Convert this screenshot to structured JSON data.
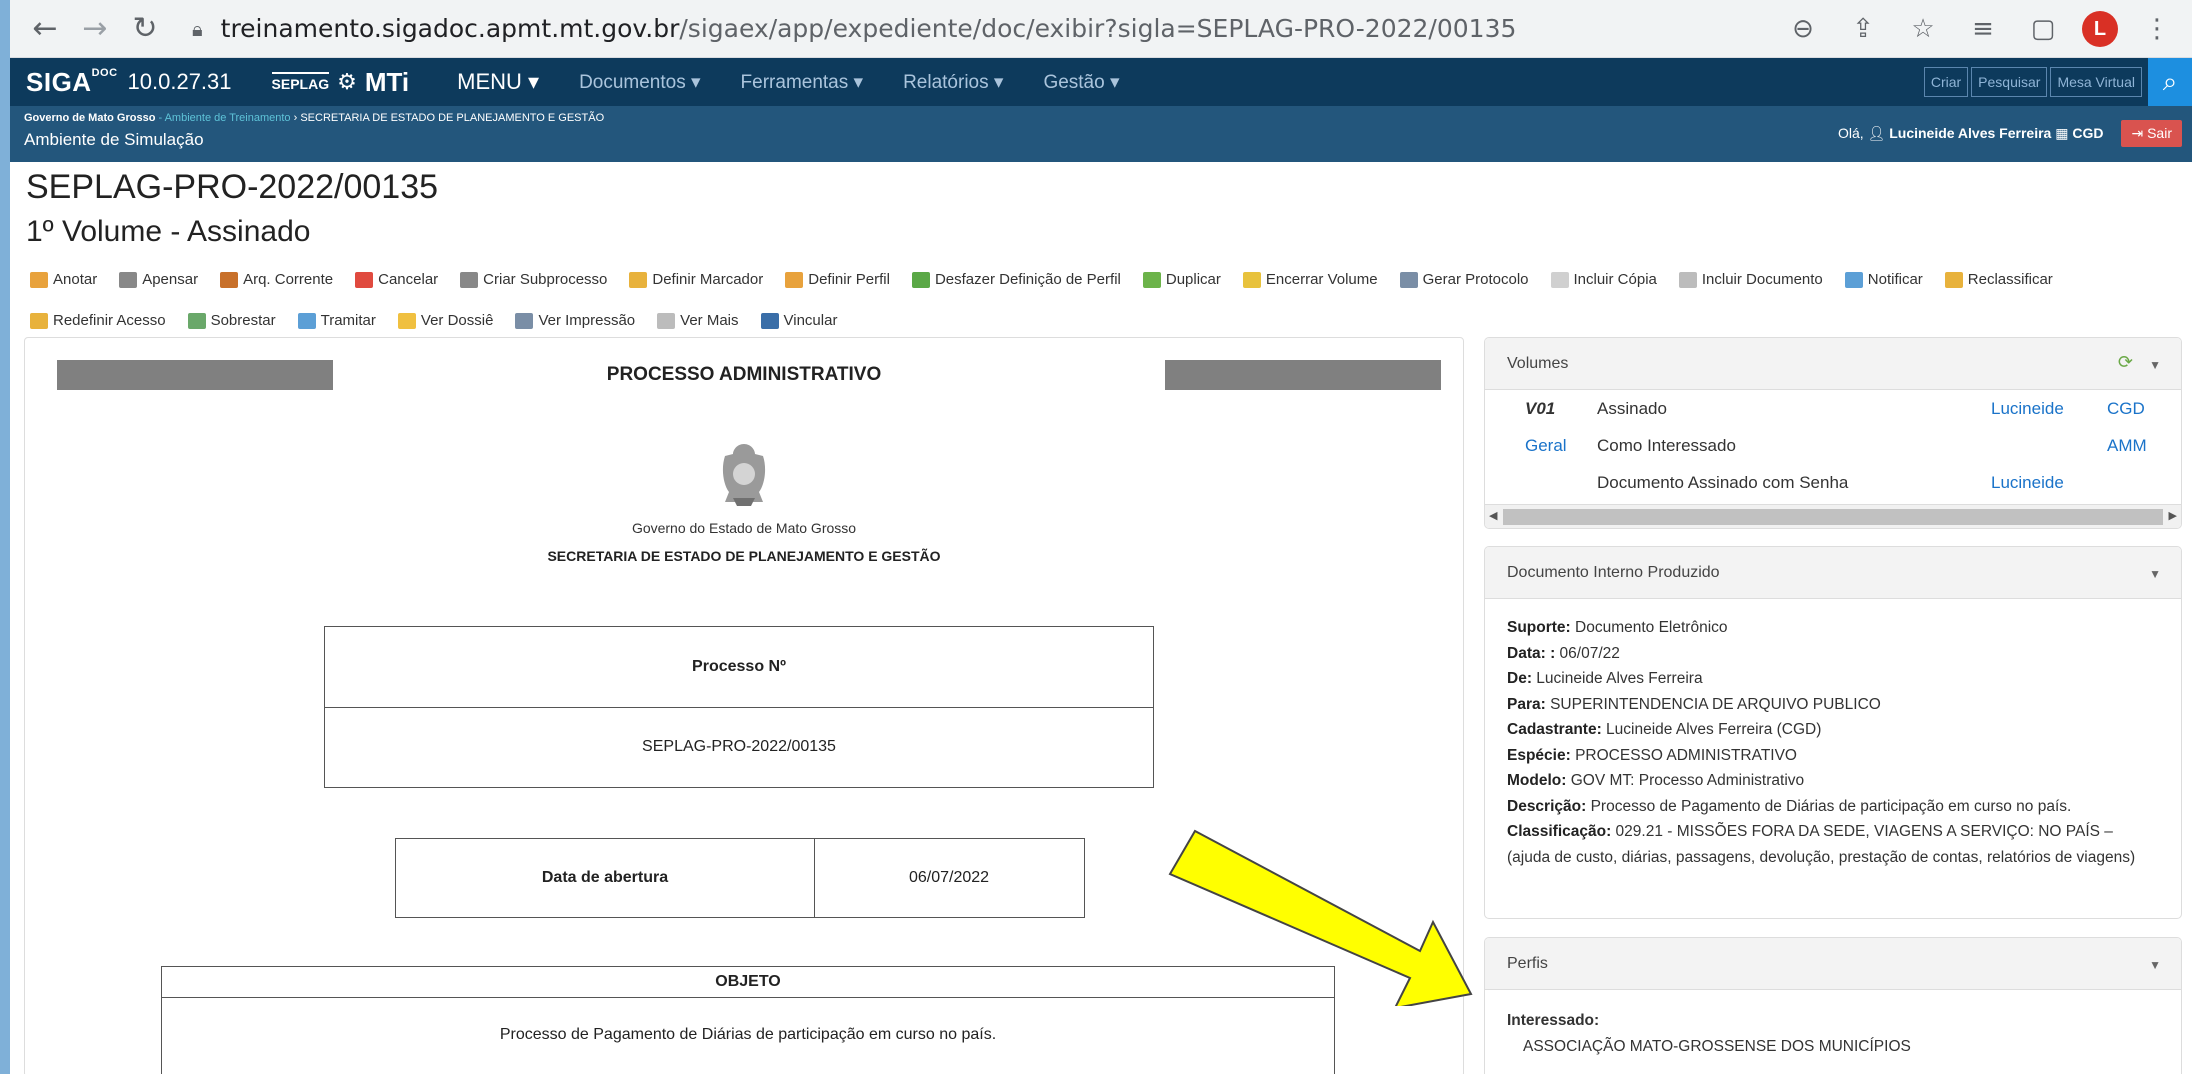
{
  "browser": {
    "url_host": "treinamento.sigadoc.apmt.mt.gov.br",
    "url_path": "/sigaex/app/expediente/doc/exibir?sigla=SEPLAG-PRO-2022/00135",
    "profile_initial": "L"
  },
  "nav": {
    "logo": "SIGA",
    "logo_sup": "DOC",
    "version": "10.0.27.31",
    "seplag": "SEPLAG",
    "mti": "MTi",
    "menu": "MENU ▾",
    "items": [
      "Documentos ▾",
      "Ferramentas ▾",
      "Relatórios ▾",
      "Gestão ▾"
    ],
    "buttons": [
      "Criar",
      "Pesquisar",
      "Mesa Virtual"
    ]
  },
  "crumb": {
    "gov": "Governo de Mato Grosso",
    "amb": " - Ambiente de Treinamento",
    "sec": " › SECRETARIA DE ESTADO DE PLANEJAMENTO E GESTÃO",
    "sim": "Ambiente de Simulação",
    "hello": "Olá,",
    "user": "Lucineide Alves Ferreira",
    "unit": "CGD",
    "logout": "Sair"
  },
  "doc": {
    "title": "SEPLAG-PRO-2022/00135",
    "volume": "1º Volume - Assinado"
  },
  "toolbar": {
    "row1": [
      {
        "label": "Anotar",
        "color": "#e8a23c"
      },
      {
        "label": "Apensar",
        "color": "#888888"
      },
      {
        "label": "Arq. Corrente",
        "color": "#c8702a"
      },
      {
        "label": "Cancelar",
        "color": "#e04a3f"
      },
      {
        "label": "Criar Subprocesso",
        "color": "#888888"
      },
      {
        "label": "Definir Marcador",
        "color": "#e8b23c"
      },
      {
        "label": "Definir Perfil",
        "color": "#e8a23c"
      },
      {
        "label": "Desfazer Definição de Perfil",
        "color": "#5aa846"
      },
      {
        "label": "Duplicar",
        "color": "#6cb34a"
      },
      {
        "label": "Encerrar Volume",
        "color": "#e8c23c"
      },
      {
        "label": "Gerar Protocolo",
        "color": "#7a8ea6"
      },
      {
        "label": "Incluir Cópia",
        "color": "#d0d0d0"
      },
      {
        "label": "Incluir Documento",
        "color": "#bcbcbc"
      },
      {
        "label": "Notificar",
        "color": "#5c9fd6"
      },
      {
        "label": "Reclassificar",
        "color": "#e8b23c"
      }
    ],
    "row2": [
      {
        "label": "Redefinir Acesso",
        "color": "#e8b23c"
      },
      {
        "label": "Sobrestar",
        "color": "#6aa86a"
      },
      {
        "label": "Tramitar",
        "color": "#5c9fd6"
      },
      {
        "label": "Ver Dossiê",
        "color": "#f0c040"
      },
      {
        "label": "Ver Impressão",
        "color": "#7a8ea6"
      },
      {
        "label": "Ver Mais",
        "color": "#bcbcbc"
      },
      {
        "label": "Vincular",
        "color": "#3a6ea8"
      }
    ]
  },
  "document": {
    "header": "PROCESSO ADMINISTRATIVO",
    "gov": "Governo do Estado de Mato Grosso",
    "sec": "SECRETARIA DE ESTADO DE PLANEJAMENTO E GESTÃO",
    "processo_label": "Processo Nº",
    "processo_value": "SEPLAG-PRO-2022/00135",
    "abertura_label": "Data de abertura",
    "abertura_value": "06/07/2022",
    "objeto_label": "OBJETO",
    "objeto_value": "Processo de Pagamento de Diárias de participação em curso no país."
  },
  "volumes": {
    "title": "Volumes",
    "rows": [
      {
        "c1": "V01",
        "c2": "Assinado",
        "c3": "Lucineide",
        "c4": "CGD"
      },
      {
        "c1": "Geral",
        "c2": "Como Interessado",
        "c3": "",
        "c4": "AMM"
      },
      {
        "c1": "",
        "c2": "Documento Assinado com Senha",
        "c3": "Lucineide",
        "c4": ""
      }
    ]
  },
  "info": {
    "title": "Documento Interno Produzido",
    "fields": [
      {
        "k": "Suporte:",
        "v": " Documento Eletrônico"
      },
      {
        "k": "Data: :",
        "v": " 06/07/22"
      },
      {
        "k": "De:",
        "v": " Lucineide Alves Ferreira"
      },
      {
        "k": "Para:",
        "v": " SUPERINTENDENCIA DE ARQUIVO PUBLICO"
      },
      {
        "k": "Cadastrante:",
        "v": " Lucineide Alves Ferreira (CGD)"
      },
      {
        "k": "Espécie:",
        "v": " PROCESSO ADMINISTRATIVO"
      },
      {
        "k": "Modelo:",
        "v": " GOV MT: Processo Administrativo"
      },
      {
        "k": "Descrição:",
        "v": " Processo de Pagamento de Diárias de participação em curso no país."
      },
      {
        "k": "Classificação:",
        "v": " 029.21 - MISSÕES FORA DA SEDE, VIAGENS A SERVIÇO: NO PAÍS – (ajuda de custo, diárias, passagens, devolução, prestação de contas, relatórios de viagens)"
      }
    ]
  },
  "perfis": {
    "title": "Perfis",
    "role": "Interessado:",
    "value": "ASSOCIAÇÃO MATO-GROSSENSE DOS MUNICÍPIOS"
  }
}
